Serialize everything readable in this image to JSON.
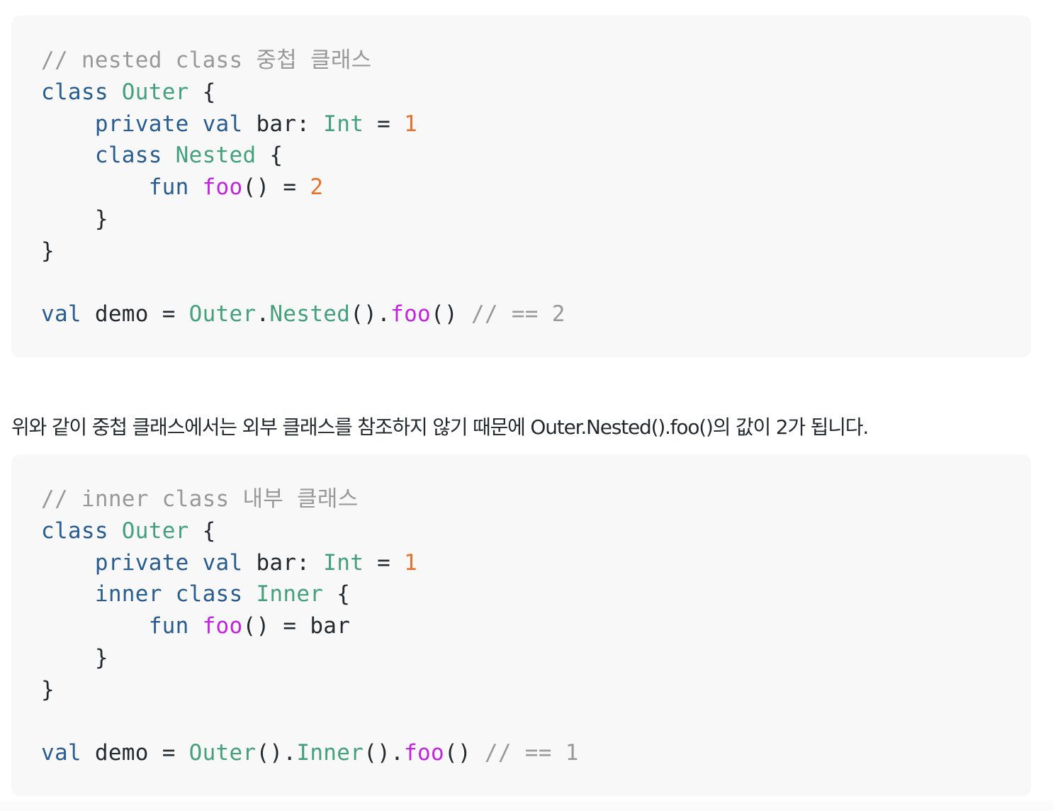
{
  "code_blocks": [
    {
      "lines": [
        [
          {
            "t": "comment",
            "v": "// nested class 중첩 클래스"
          }
        ],
        [
          {
            "t": "keyword",
            "v": "class"
          },
          {
            "t": "plain",
            "v": " "
          },
          {
            "t": "type",
            "v": "Outer"
          },
          {
            "t": "plain",
            "v": " {"
          }
        ],
        [
          {
            "t": "plain",
            "v": "    "
          },
          {
            "t": "keyword",
            "v": "private"
          },
          {
            "t": "plain",
            "v": " "
          },
          {
            "t": "keyword",
            "v": "val"
          },
          {
            "t": "plain",
            "v": " bar: "
          },
          {
            "t": "type",
            "v": "Int"
          },
          {
            "t": "plain",
            "v": " = "
          },
          {
            "t": "number",
            "v": "1"
          }
        ],
        [
          {
            "t": "plain",
            "v": "    "
          },
          {
            "t": "keyword",
            "v": "class"
          },
          {
            "t": "plain",
            "v": " "
          },
          {
            "t": "type",
            "v": "Nested"
          },
          {
            "t": "plain",
            "v": " {"
          }
        ],
        [
          {
            "t": "plain",
            "v": "        "
          },
          {
            "t": "keyword",
            "v": "fun"
          },
          {
            "t": "plain",
            "v": " "
          },
          {
            "t": "func",
            "v": "foo"
          },
          {
            "t": "plain",
            "v": "() = "
          },
          {
            "t": "number",
            "v": "2"
          }
        ],
        [
          {
            "t": "plain",
            "v": "    }"
          }
        ],
        [
          {
            "t": "plain",
            "v": "}"
          }
        ],
        [
          {
            "t": "plain",
            "v": ""
          }
        ],
        [
          {
            "t": "keyword",
            "v": "val"
          },
          {
            "t": "plain",
            "v": " demo = "
          },
          {
            "t": "type",
            "v": "Outer"
          },
          {
            "t": "plain",
            "v": "."
          },
          {
            "t": "type",
            "v": "Nested"
          },
          {
            "t": "plain",
            "v": "()."
          },
          {
            "t": "func",
            "v": "foo"
          },
          {
            "t": "plain",
            "v": "() "
          },
          {
            "t": "comment",
            "v": "// == 2"
          }
        ]
      ]
    },
    {
      "lines": [
        [
          {
            "t": "comment",
            "v": "// inner class 내부 클래스"
          }
        ],
        [
          {
            "t": "keyword",
            "v": "class"
          },
          {
            "t": "plain",
            "v": " "
          },
          {
            "t": "type",
            "v": "Outer"
          },
          {
            "t": "plain",
            "v": " {"
          }
        ],
        [
          {
            "t": "plain",
            "v": "    "
          },
          {
            "t": "keyword",
            "v": "private"
          },
          {
            "t": "plain",
            "v": " "
          },
          {
            "t": "keyword",
            "v": "val"
          },
          {
            "t": "plain",
            "v": " bar: "
          },
          {
            "t": "type",
            "v": "Int"
          },
          {
            "t": "plain",
            "v": " = "
          },
          {
            "t": "number",
            "v": "1"
          }
        ],
        [
          {
            "t": "plain",
            "v": "    "
          },
          {
            "t": "keyword",
            "v": "inner class"
          },
          {
            "t": "plain",
            "v": " "
          },
          {
            "t": "type",
            "v": "Inner"
          },
          {
            "t": "plain",
            "v": " {"
          }
        ],
        [
          {
            "t": "plain",
            "v": "        "
          },
          {
            "t": "keyword",
            "v": "fun"
          },
          {
            "t": "plain",
            "v": " "
          },
          {
            "t": "func",
            "v": "foo"
          },
          {
            "t": "plain",
            "v": "() = bar"
          }
        ],
        [
          {
            "t": "plain",
            "v": "    }"
          }
        ],
        [
          {
            "t": "plain",
            "v": "}"
          }
        ],
        [
          {
            "t": "plain",
            "v": ""
          }
        ],
        [
          {
            "t": "keyword",
            "v": "val"
          },
          {
            "t": "plain",
            "v": " demo = "
          },
          {
            "t": "type",
            "v": "Outer"
          },
          {
            "t": "plain",
            "v": "()."
          },
          {
            "t": "type",
            "v": "Inner"
          },
          {
            "t": "plain",
            "v": "()."
          },
          {
            "t": "func",
            "v": "foo"
          },
          {
            "t": "plain",
            "v": "() "
          },
          {
            "t": "comment",
            "v": "// == 1"
          }
        ]
      ]
    }
  ],
  "paragraph": {
    "text": "위와 같이 중첩 클래스에서는 외부 클래스를 참조하지 않기 때문에 Outer.Nested().foo()의 값이 2가 됩니다."
  },
  "colors": {
    "code_background": "#f8f8f8",
    "comment": "#999999",
    "keyword": "#2a5d8f",
    "type": "#45a17d",
    "number": "#e8712c",
    "function": "#c123df",
    "text": "#24292e"
  }
}
